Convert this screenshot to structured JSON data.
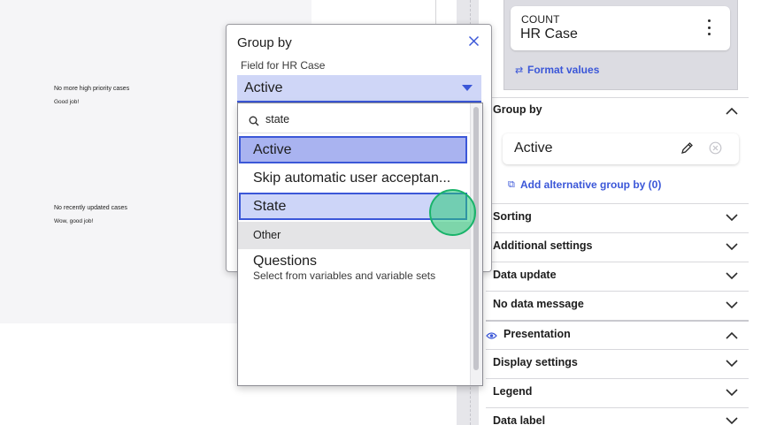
{
  "canvas": {
    "widget1": {
      "title": "No more high priority cases",
      "subtitle": "Good job!"
    },
    "widget2": {
      "title": "No recently updated cases",
      "subtitle": "Wow, good job!"
    }
  },
  "panel": {
    "metric": {
      "label": "COUNT",
      "value": "HR Case",
      "menu_icon": "kebab-icon"
    },
    "format_values": "Format values",
    "group_by": {
      "title": "Group by",
      "item": "Active",
      "add_alternative": "Add alternative group by (0)"
    },
    "sections": {
      "sorting": "Sorting",
      "additional_settings": "Additional settings",
      "data_update": "Data update",
      "no_data_message": "No data message",
      "presentation": "Presentation",
      "display_settings": "Display settings",
      "legend": "Legend",
      "data_label": "Data label"
    }
  },
  "modal": {
    "title": "Group by",
    "field_label": "Field for HR Case",
    "selected_value": "Active",
    "search": {
      "value": "state"
    },
    "options": [
      {
        "label": "Active",
        "state": "selected"
      },
      {
        "label": "Skip automatic user acceptan...",
        "state": "normal"
      },
      {
        "label": "State",
        "state": "hover"
      }
    ],
    "group_header": "Other",
    "other_option": {
      "label": "Questions",
      "description": "Select from variables and variable sets"
    }
  },
  "colors": {
    "accent": "#3b57d8",
    "selected_bg": "#a9b3f0",
    "hover_bg": "#cdd5f8",
    "cursor": "#19b36a"
  }
}
